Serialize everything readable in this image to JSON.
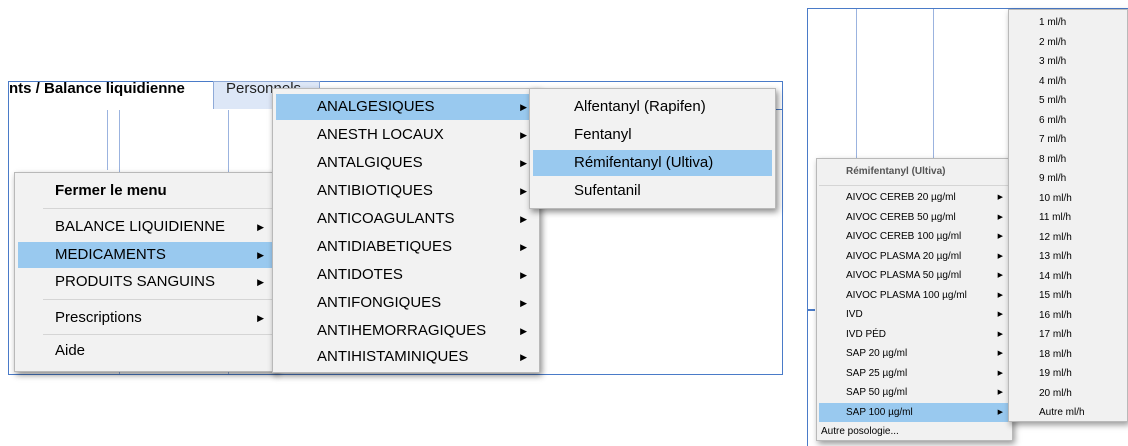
{
  "left": {
    "title": "nts / Balance liquidienne",
    "tab": "Personnels",
    "context_menu": {
      "close": "Fermer le menu",
      "items": [
        "BALANCE LIQUIDIENNE",
        "MEDICAMENTS",
        "PRODUITS SANGUINS"
      ],
      "prescriptions": "Prescriptions",
      "help": "Aide",
      "selected": "MEDICAMENTS"
    },
    "med_menu": {
      "items": [
        "ANALGESIQUES",
        "ANESTH LOCAUX",
        "ANTALGIQUES",
        "ANTIBIOTIQUES",
        "ANTICOAGULANTS",
        "ANTIDIABETIQUES",
        "ANTIDOTES",
        "ANTIFONGIQUES",
        "ANTIHEMORRAGIQUES",
        "ANTIHISTAMINIQUES"
      ],
      "selected": "ANALGESIQUES"
    },
    "analgesic_menu": {
      "items": [
        "Alfentanyl (Rapifen)",
        "Fentanyl",
        "Rémifentanyl (Ultiva)",
        "Sufentanil"
      ],
      "selected": "Rémifentanyl (Ultiva)"
    }
  },
  "right": {
    "remi_menu": {
      "header": "Rémifentanyl (Ultiva)",
      "items": [
        "AIVOC CEREB 20 µg/ml",
        "AIVOC CEREB 50 µg/ml",
        "AIVOC CEREB 100 µg/ml",
        "AIVOC PLASMA 20 µg/ml",
        "AIVOC PLASMA 50 µg/ml",
        "AIVOC PLASMA 100 µg/ml",
        "IVD",
        "IVD PÉD",
        "SAP 20 µg/ml",
        "SAP 25 µg/ml",
        "SAP 50 µg/ml",
        "SAP 100 µg/ml"
      ],
      "selected": "SAP 100 µg/ml",
      "other": "Autre posologie..."
    },
    "rate_menu": {
      "items": [
        "1 ml/h",
        "2 ml/h",
        "3 ml/h",
        "4 ml/h",
        "5 ml/h",
        "6 ml/h",
        "7 ml/h",
        "8 ml/h",
        "9 ml/h",
        "10 ml/h",
        "11 ml/h",
        "12 ml/h",
        "13 ml/h",
        "14 ml/h",
        "15 ml/h",
        "16 ml/h",
        "17 ml/h",
        "18 ml/h",
        "19 ml/h",
        "20 ml/h",
        "Autre ml/h"
      ]
    }
  },
  "colors": {
    "highlight": "#99c9ef",
    "menu_bg": "#f2f2f2",
    "window_border": "#4a7bc8"
  },
  "icons": {
    "submenu_arrow": "triangle-right-icon"
  }
}
